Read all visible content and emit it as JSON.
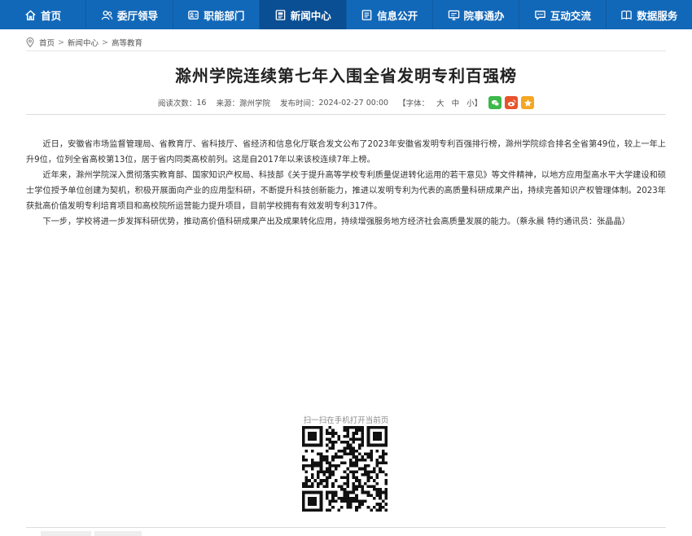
{
  "nav": {
    "items": [
      {
        "label": "首页",
        "icon": "home-icon"
      },
      {
        "label": "委厅领导",
        "icon": "leaders-icon"
      },
      {
        "label": "职能部门",
        "icon": "departments-icon"
      },
      {
        "label": "新闻中心",
        "icon": "news-icon",
        "active": true
      },
      {
        "label": "信息公开",
        "icon": "info-icon"
      },
      {
        "label": "院事通办",
        "icon": "services-icon"
      },
      {
        "label": "互动交流",
        "icon": "chat-icon"
      },
      {
        "label": "数据服务",
        "icon": "data-icon"
      }
    ]
  },
  "breadcrumb": {
    "home": "首页",
    "sep1": ">",
    "section": "新闻中心",
    "sep2": ">",
    "current": "高等教育"
  },
  "article": {
    "title": "滁州学院连续第七年入围全省发明专利百强榜",
    "meta": {
      "views_label": "阅读次数：",
      "views": "16",
      "source_label": "来源：",
      "source": "滁州学院",
      "date_label": "发布时间：",
      "date": "2024-02-27 00:00",
      "fontsize_label": "【字体：",
      "font_large": "大",
      "font_medium": "中",
      "font_small": "小",
      "fontsize_close": "】"
    },
    "paragraphs": [
      "近日，安徽省市场监督管理局、省教育厅、省科技厅、省经济和信息化厅联合发文公布了2023年安徽省发明专利百强排行榜，滁州学院综合排名全省第49位，较上一年上升9位，位列全省高校第13位，居于省内同类高校前列。这是自2017年以来该校连续7年上榜。",
      "近年来，滁州学院深入贯彻落实教育部、国家知识产权局、科技部《关于提升高等学校专利质量促进转化运用的若干意见》等文件精神，以地方应用型高水平大学建设和硕士学位授予单位创建为契机，积极开展面向产业的应用型科研，不断提升科技创新能力，推进以发明专利为代表的高质量科研成果产出，持续完善知识产权管理体制。2023年获批高价值发明专利培育项目和高校院所运营能力提升项目，目前学校拥有有效发明专利317件。",
      "下一步，学校将进一步发挥科研优势，推动高价值科研成果产出及成果转化应用，持续增强服务地方经济社会高质量发展的能力。（蔡永晨 特约通讯员：张晶晶）"
    ]
  },
  "qr": {
    "label": "扫一扫在手机打开当前页"
  },
  "colors": {
    "nav_bg": "#1268b8",
    "nav_active": "#0a4f93",
    "wechat": "#3db84a",
    "weibo": "#e8532c",
    "favorite": "#f5a623"
  }
}
